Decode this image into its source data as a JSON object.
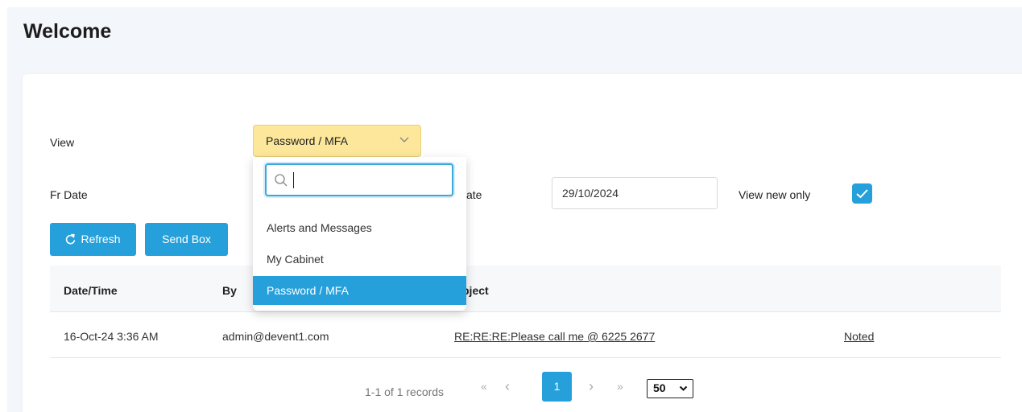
{
  "page": {
    "title": "Welcome"
  },
  "filters": {
    "view_label": "View",
    "view_selected": "Password / MFA",
    "from_date_label": "Fr Date",
    "to_date_label_visible": "ate",
    "to_date_value": "29/10/2024",
    "view_new_only_label": "View new only",
    "view_new_only_checked": true
  },
  "buttons": {
    "refresh": "Refresh",
    "send_box": "Send Box"
  },
  "dropdown": {
    "search_value": "",
    "options": [
      "Alerts and Messages",
      "My Cabinet",
      "Password / MFA"
    ],
    "selected_index": 2
  },
  "table": {
    "headers": [
      "Date/Time",
      "By",
      "bject"
    ],
    "rows": [
      {
        "datetime": "16-Oct-24 3:36 AM",
        "by": "admin@devent1.com",
        "subject": "RE:RE:RE:Please call me @ 6225 2677",
        "action": "Noted"
      }
    ]
  },
  "pagination": {
    "info": "1-1 of 1 records",
    "first": "«",
    "prev": "‹",
    "current": "1",
    "next": "›",
    "last": "»",
    "page_size": "50"
  },
  "colors": {
    "accent": "#26a0da",
    "select_bg": "#fde79a",
    "page_bg": "#f3f6fa"
  }
}
